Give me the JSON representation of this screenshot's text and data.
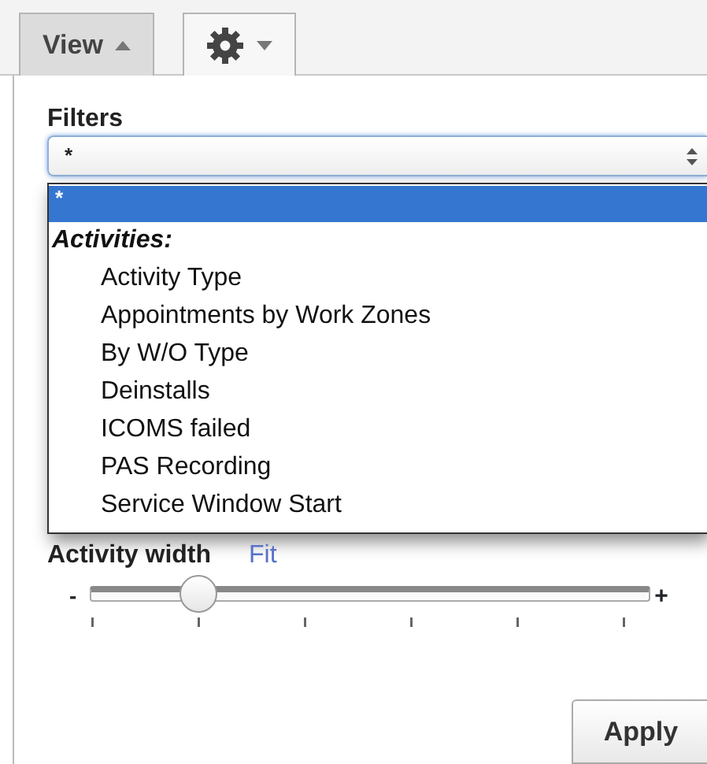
{
  "toolbar": {
    "buttons": [
      {
        "kind": "text",
        "label": "View",
        "expanded": true
      },
      {
        "kind": "gear",
        "expanded": false
      }
    ]
  },
  "filters": {
    "label": "Filters",
    "value": "*",
    "options": [
      {
        "kind": "option",
        "label": "*",
        "selected": true
      },
      {
        "kind": "group",
        "label": "Activities:"
      },
      {
        "kind": "option",
        "label": "Activity Type",
        "selected": false
      },
      {
        "kind": "option",
        "label": "Appointments by Work Zones",
        "selected": false
      },
      {
        "kind": "option",
        "label": "By W/O Type",
        "selected": false
      },
      {
        "kind": "option",
        "label": "Deinstalls",
        "selected": false
      },
      {
        "kind": "option",
        "label": "ICOMS failed",
        "selected": false
      },
      {
        "kind": "option",
        "label": "PAS Recording",
        "selected": false
      },
      {
        "kind": "option",
        "label": "Service Window Start",
        "selected": false
      }
    ]
  },
  "activity_width": {
    "label": "Activity width",
    "link": "Fit",
    "min_label": "-",
    "max_label": "+",
    "level": 0.17
  },
  "buttons": [
    {
      "label": "Apply"
    }
  ]
}
